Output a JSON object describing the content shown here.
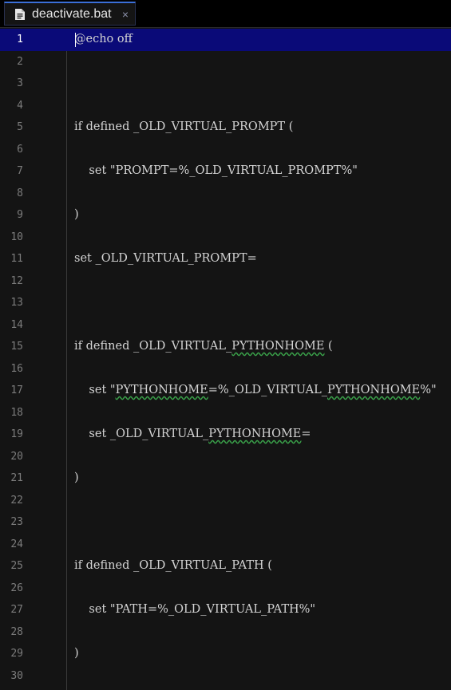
{
  "tab": {
    "label": "deactivate.bat",
    "close_glyph": "×"
  },
  "colors": {
    "active_line": "#0a0a78",
    "background": "#141414",
    "tab_accent": "#3b6fd8"
  },
  "active_line": 1,
  "lines": [
    {
      "n": "1",
      "text": "@echo off"
    },
    {
      "n": "2",
      "text": ""
    },
    {
      "n": "3",
      "text": ""
    },
    {
      "n": "4",
      "text": ""
    },
    {
      "n": "5",
      "text": "if defined _OLD_VIRTUAL_PROMPT ("
    },
    {
      "n": "6",
      "text": ""
    },
    {
      "n": "7",
      "text": "    set \"PROMPT=%_OLD_VIRTUAL_PROMPT%\""
    },
    {
      "n": "8",
      "text": ""
    },
    {
      "n": "9",
      "text": ")"
    },
    {
      "n": "10",
      "text": ""
    },
    {
      "n": "11",
      "text": "set _OLD_VIRTUAL_PROMPT="
    },
    {
      "n": "12",
      "text": ""
    },
    {
      "n": "13",
      "text": ""
    },
    {
      "n": "14",
      "text": ""
    },
    {
      "n": "15",
      "text": "if defined _OLD_VIRTUAL_PYTHONHOME ("
    },
    {
      "n": "16",
      "text": ""
    },
    {
      "n": "17",
      "text": "    set \"PYTHONHOME=%_OLD_VIRTUAL_PYTHONHOME%\""
    },
    {
      "n": "18",
      "text": ""
    },
    {
      "n": "19",
      "text": "    set _OLD_VIRTUAL_PYTHONHOME="
    },
    {
      "n": "20",
      "text": ""
    },
    {
      "n": "21",
      "text": ")"
    },
    {
      "n": "22",
      "text": ""
    },
    {
      "n": "23",
      "text": ""
    },
    {
      "n": "24",
      "text": ""
    },
    {
      "n": "25",
      "text": "if defined _OLD_VIRTUAL_PATH ("
    },
    {
      "n": "26",
      "text": ""
    },
    {
      "n": "27",
      "text": "    set \"PATH=%_OLD_VIRTUAL_PATH%\""
    },
    {
      "n": "28",
      "text": ""
    },
    {
      "n": "29",
      "text": ")"
    },
    {
      "n": "30",
      "text": ""
    }
  ]
}
